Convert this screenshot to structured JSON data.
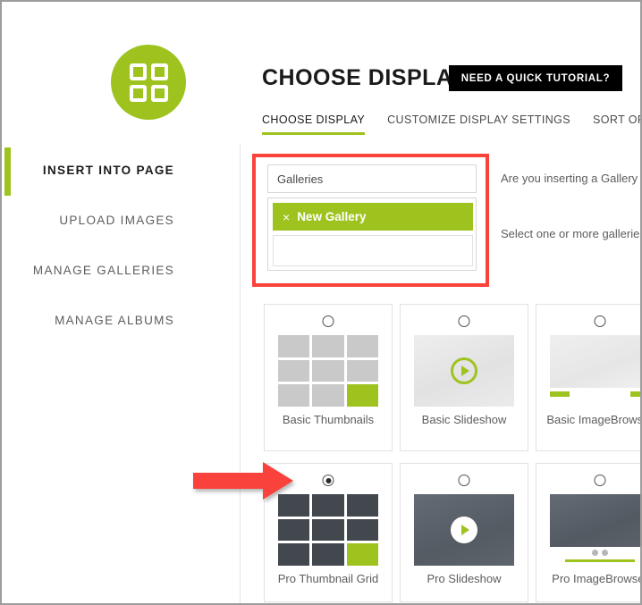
{
  "brand": {
    "accent_green": "#9ec31e",
    "highlight_red": "#f9423a",
    "logo_icon": "grid-squares-icon"
  },
  "header": {
    "title": "CHOOSE DISPLAY",
    "tutorial_button": "NEED A QUICK TUTORIAL?"
  },
  "tabs": [
    {
      "label": "CHOOSE DISPLAY",
      "active": true
    },
    {
      "label": "CUSTOMIZE DISPLAY SETTINGS",
      "active": false
    },
    {
      "label": "SORT OR",
      "active": false
    }
  ],
  "sidebar": {
    "items": [
      {
        "label": "INSERT INTO PAGE",
        "active": true
      },
      {
        "label": "UPLOAD IMAGES",
        "active": false
      },
      {
        "label": "MANAGE GALLERIES",
        "active": false
      },
      {
        "label": "MANAGE ALBUMS",
        "active": false
      }
    ]
  },
  "gallery_picker": {
    "type_select_value": "Galleries",
    "selected_tag": "New Gallery",
    "tag_remove_icon": "×",
    "search_value": "",
    "search_placeholder": ""
  },
  "help": {
    "line1": "Are you inserting a Gallery",
    "line2": "Select one or more galleries"
  },
  "displays": {
    "rows": [
      {
        "cards": [
          {
            "label": "Basic Thumbnails",
            "selected": false,
            "thumb": "grid-light"
          },
          {
            "label": "Basic Slideshow",
            "selected": false,
            "thumb": "slideshow-light"
          },
          {
            "label": "Basic ImageBrowser",
            "selected": false,
            "thumb": "browser-light"
          }
        ]
      },
      {
        "cards": [
          {
            "label": "Pro Thumbnail Grid",
            "selected": true,
            "thumb": "grid-dark"
          },
          {
            "label": "Pro Slideshow",
            "selected": false,
            "thumb": "slideshow-dark"
          },
          {
            "label": "Pro ImageBrowser",
            "selected": false,
            "thumb": "browser-dark"
          }
        ]
      }
    ]
  },
  "annotations": {
    "arrow_icon": "red-arrow-right-icon",
    "highlight_box_icon": "red-highlight-box"
  }
}
